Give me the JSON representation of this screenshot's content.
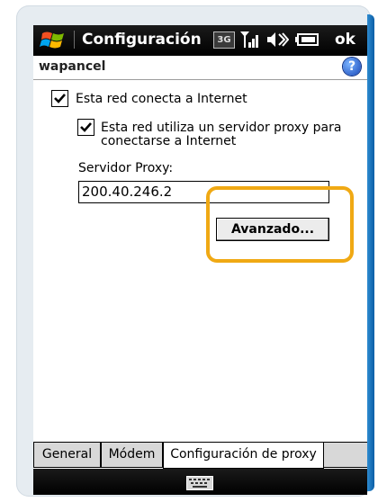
{
  "titlebar": {
    "title": "Configuración",
    "status_3g": "3G",
    "ok_label": "ok"
  },
  "subbar": {
    "subtitle": "wapancel",
    "help_symbol": "?"
  },
  "options": {
    "connect_internet_label": "Esta red conecta a Internet",
    "connect_internet_checked": true,
    "proxy_label_line1": "Esta red utiliza un servidor proxy para",
    "proxy_label_line2": "conectarse a Internet",
    "proxy_checked": true
  },
  "proxy": {
    "server_label": "Servidor Proxy:",
    "server_value": "200.40.246.2",
    "advanced_label": "Avanzado..."
  },
  "tabs": [
    {
      "label": "General",
      "active": false
    },
    {
      "label": "Módem",
      "active": false
    },
    {
      "label": "Configuración de proxy",
      "active": true
    }
  ],
  "icons": {
    "windows_logo": "windows-logo-icon",
    "signal": "signal-strength-icon",
    "volume": "volume-icon",
    "battery": "battery-icon",
    "help": "help-icon",
    "keyboard": "keyboard-icon"
  },
  "colors": {
    "highlight": "#f0a914",
    "titlebar": "#000000",
    "help": "#1646b8"
  }
}
